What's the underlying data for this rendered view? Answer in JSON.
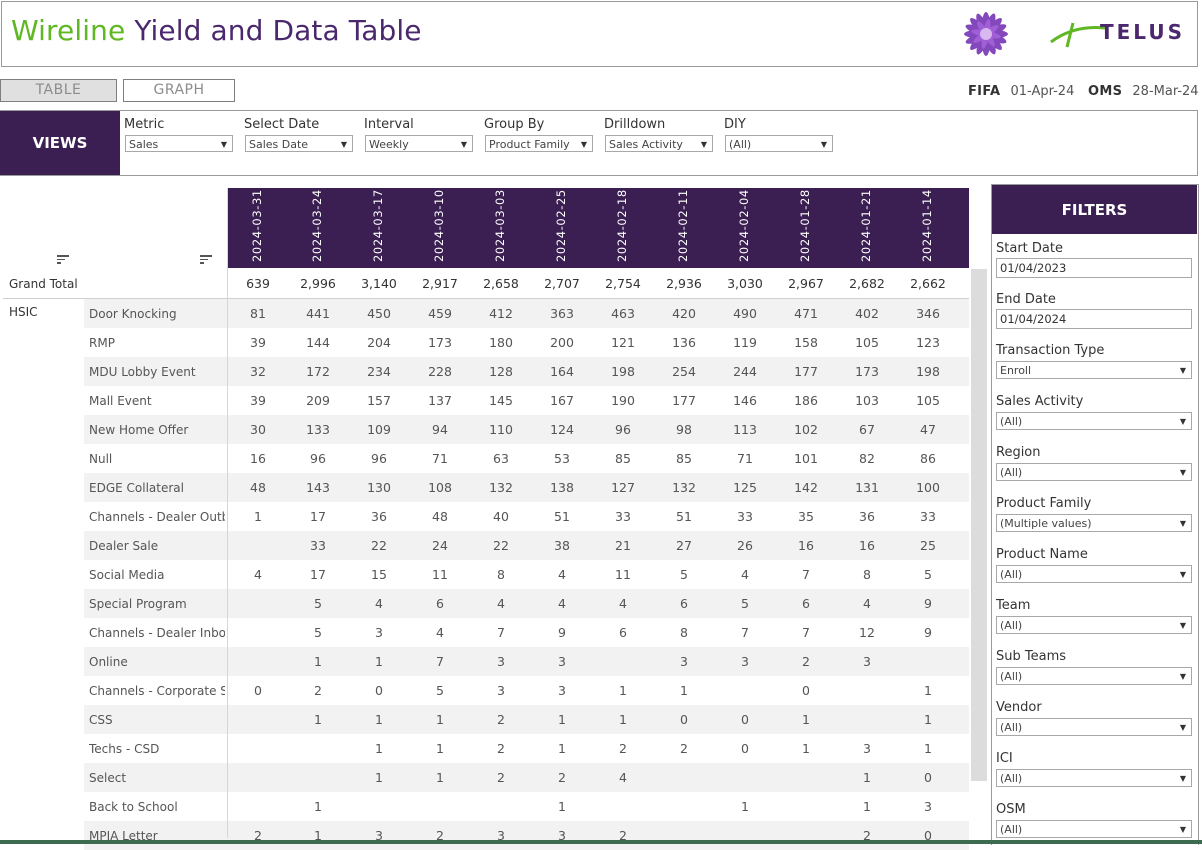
{
  "title": {
    "part1": "Wireline",
    "part2": " Yield and Data Table"
  },
  "brand": {
    "name": "TELUS"
  },
  "tabs": [
    "TABLE",
    "GRAPH"
  ],
  "asof": {
    "fifa_label": "FIFA",
    "fifa_value": "01-Apr-24",
    "oms_label": "OMS",
    "oms_value": "28-Mar-24"
  },
  "views": {
    "label": "VIEWS",
    "params": [
      {
        "label": "Metric",
        "value": "Sales"
      },
      {
        "label": "Select Date",
        "value": "Sales Date"
      },
      {
        "label": "Interval",
        "value": "Weekly"
      },
      {
        "label": "Group By",
        "value": "Product Family"
      },
      {
        "label": "Drilldown",
        "value": "Sales Activity"
      },
      {
        "label": "DIY",
        "value": "(All)"
      }
    ]
  },
  "table": {
    "dates": [
      "2024-03-31",
      "2024-03-24",
      "2024-03-17",
      "2024-03-10",
      "2024-03-03",
      "2024-02-25",
      "2024-02-18",
      "2024-02-11",
      "2024-02-04",
      "2024-01-28",
      "2024-01-21",
      "2024-01-14"
    ],
    "grand_total_label": "Grand Total",
    "grand_total": [
      "639",
      "2,996",
      "3,140",
      "2,917",
      "2,658",
      "2,707",
      "2,754",
      "2,936",
      "3,030",
      "2,967",
      "2,682",
      "2,662"
    ],
    "group": "HSIC",
    "rows": [
      {
        "label": "Door Knocking",
        "values": [
          "81",
          "441",
          "450",
          "459",
          "412",
          "363",
          "463",
          "420",
          "490",
          "471",
          "402",
          "346"
        ]
      },
      {
        "label": "RMP",
        "values": [
          "39",
          "144",
          "204",
          "173",
          "180",
          "200",
          "121",
          "136",
          "119",
          "158",
          "105",
          "123"
        ]
      },
      {
        "label": "MDU Lobby Event",
        "values": [
          "32",
          "172",
          "234",
          "228",
          "128",
          "164",
          "198",
          "254",
          "244",
          "177",
          "173",
          "198"
        ]
      },
      {
        "label": "Mall Event",
        "values": [
          "39",
          "209",
          "157",
          "137",
          "145",
          "167",
          "190",
          "177",
          "146",
          "186",
          "103",
          "105"
        ]
      },
      {
        "label": "New Home Offer",
        "values": [
          "30",
          "133",
          "109",
          "94",
          "110",
          "124",
          "96",
          "98",
          "113",
          "102",
          "67",
          "47"
        ]
      },
      {
        "label": "Null",
        "values": [
          "16",
          "96",
          "96",
          "71",
          "63",
          "53",
          "85",
          "85",
          "71",
          "101",
          "82",
          "86"
        ]
      },
      {
        "label": "EDGE Collateral",
        "values": [
          "48",
          "143",
          "130",
          "108",
          "132",
          "138",
          "127",
          "132",
          "125",
          "142",
          "131",
          "100"
        ]
      },
      {
        "label": "Channels - Dealer Outb..",
        "values": [
          "1",
          "17",
          "36",
          "48",
          "40",
          "51",
          "33",
          "51",
          "33",
          "35",
          "36",
          "33"
        ]
      },
      {
        "label": "Dealer Sale",
        "values": [
          "",
          "33",
          "22",
          "24",
          "22",
          "38",
          "21",
          "27",
          "26",
          "16",
          "16",
          "25"
        ]
      },
      {
        "label": "Social Media",
        "values": [
          "4",
          "17",
          "15",
          "11",
          "8",
          "4",
          "11",
          "5",
          "4",
          "7",
          "8",
          "5"
        ]
      },
      {
        "label": "Special Program",
        "values": [
          "",
          "5",
          "4",
          "6",
          "4",
          "4",
          "4",
          "6",
          "5",
          "6",
          "4",
          "9"
        ]
      },
      {
        "label": "Channels - Dealer Inbo..",
        "values": [
          "",
          "5",
          "3",
          "4",
          "7",
          "9",
          "6",
          "8",
          "7",
          "7",
          "12",
          "9"
        ]
      },
      {
        "label": "Online",
        "values": [
          "",
          "1",
          "1",
          "7",
          "3",
          "3",
          "",
          "3",
          "3",
          "2",
          "3",
          ""
        ]
      },
      {
        "label": "Channels - Corporate S..",
        "values": [
          "0",
          "2",
          "0",
          "5",
          "3",
          "3",
          "1",
          "1",
          "",
          "0",
          "",
          "1"
        ]
      },
      {
        "label": "CSS",
        "values": [
          "",
          "1",
          "1",
          "1",
          "2",
          "1",
          "1",
          "0",
          "0",
          "1",
          "",
          "1"
        ]
      },
      {
        "label": "Techs - CSD",
        "values": [
          "",
          "",
          "1",
          "1",
          "2",
          "1",
          "2",
          "2",
          "0",
          "1",
          "3",
          "1"
        ]
      },
      {
        "label": "Select",
        "values": [
          "",
          "",
          "1",
          "1",
          "2",
          "2",
          "4",
          "",
          "",
          "",
          "1",
          "0"
        ]
      },
      {
        "label": "Back to School",
        "values": [
          "",
          "1",
          "",
          "",
          "",
          "1",
          "",
          "",
          "1",
          "",
          "1",
          "3"
        ]
      },
      {
        "label": "MPIA Letter",
        "values": [
          "2",
          "1",
          "3",
          "2",
          "3",
          "3",
          "2",
          "",
          "",
          "",
          "2",
          "0"
        ]
      }
    ]
  },
  "filters": {
    "title": "FILTERS",
    "start_date_label": "Start Date",
    "start_date": "01/04/2023",
    "end_date_label": "End Date",
    "end_date": "01/04/2024",
    "dropdowns": [
      {
        "label": "Transaction Type",
        "value": "Enroll"
      },
      {
        "label": "Sales Activity",
        "value": "(All)"
      },
      {
        "label": "Region",
        "value": "(All)"
      },
      {
        "label": "Product Family",
        "value": "(Multiple values)"
      },
      {
        "label": "Product Name",
        "value": "(All)"
      },
      {
        "label": "Team",
        "value": "(All)"
      },
      {
        "label": "Sub Teams",
        "value": "(All)"
      },
      {
        "label": "Vendor",
        "value": "(All)"
      },
      {
        "label": "ICI",
        "value": "(All)"
      },
      {
        "label": "OSM",
        "value": "(All)"
      }
    ]
  },
  "colors": {
    "purple": "#4b286d",
    "dark_purple": "#3b1f52",
    "green": "#5fb823"
  },
  "icons": {
    "sort": "sort-icon",
    "dropdown": "chevron-down-icon",
    "logo_flower": "flower-logo-icon"
  }
}
